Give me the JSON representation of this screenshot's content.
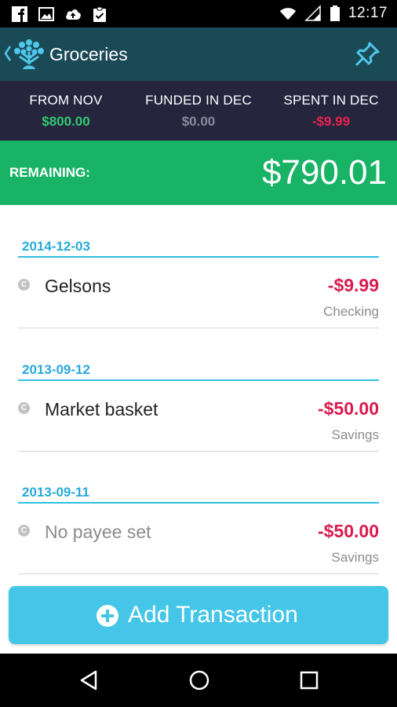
{
  "status_bar": {
    "time": "12:17",
    "left_icons": [
      "facebook-icon",
      "image-icon",
      "cloud-upload-icon",
      "clipboard-check-icon"
    ],
    "right_icons": [
      "wifi-icon",
      "signal-icon",
      "battery-icon"
    ]
  },
  "app_bar": {
    "title": "Groceries",
    "back_icon": "chevron-left-icon",
    "logo_icon": "tree-logo-icon",
    "action_icon": "pin-icon"
  },
  "summary": {
    "from_label": "FROM NOV",
    "from_value": "$800.00",
    "funded_label": "FUNDED IN DEC",
    "funded_value": "$0.00",
    "spent_label": "SPENT IN DEC",
    "spent_value": "-$9.99"
  },
  "remaining": {
    "label": "REMAINING:",
    "amount": "$790.01"
  },
  "transactions": [
    {
      "date": "2014-12-03",
      "payee": "Gelsons",
      "amount": "-$9.99",
      "account": "Checking",
      "cleared_glyph": "C"
    },
    {
      "date": "2013-09-12",
      "payee": "Market basket",
      "amount": "-$50.00",
      "account": "Savings",
      "cleared_glyph": "C"
    },
    {
      "date": "2013-09-11",
      "payee": "No payee set",
      "amount": "-$50.00",
      "account": "Savings",
      "cleared_glyph": "C"
    }
  ],
  "add_button": {
    "label": "Add Transaction",
    "icon": "plus-circle-icon"
  },
  "nav_bar": {
    "icons": [
      "back-triangle-icon",
      "home-circle-icon",
      "recents-square-icon"
    ]
  },
  "colors": {
    "app_bar": "#1b4a57",
    "summary_bg": "#26253e",
    "remaining_bg": "#19b366",
    "accent_blue": "#45c6e8",
    "negative": "#d81b4e",
    "positive": "#2ecc71"
  }
}
